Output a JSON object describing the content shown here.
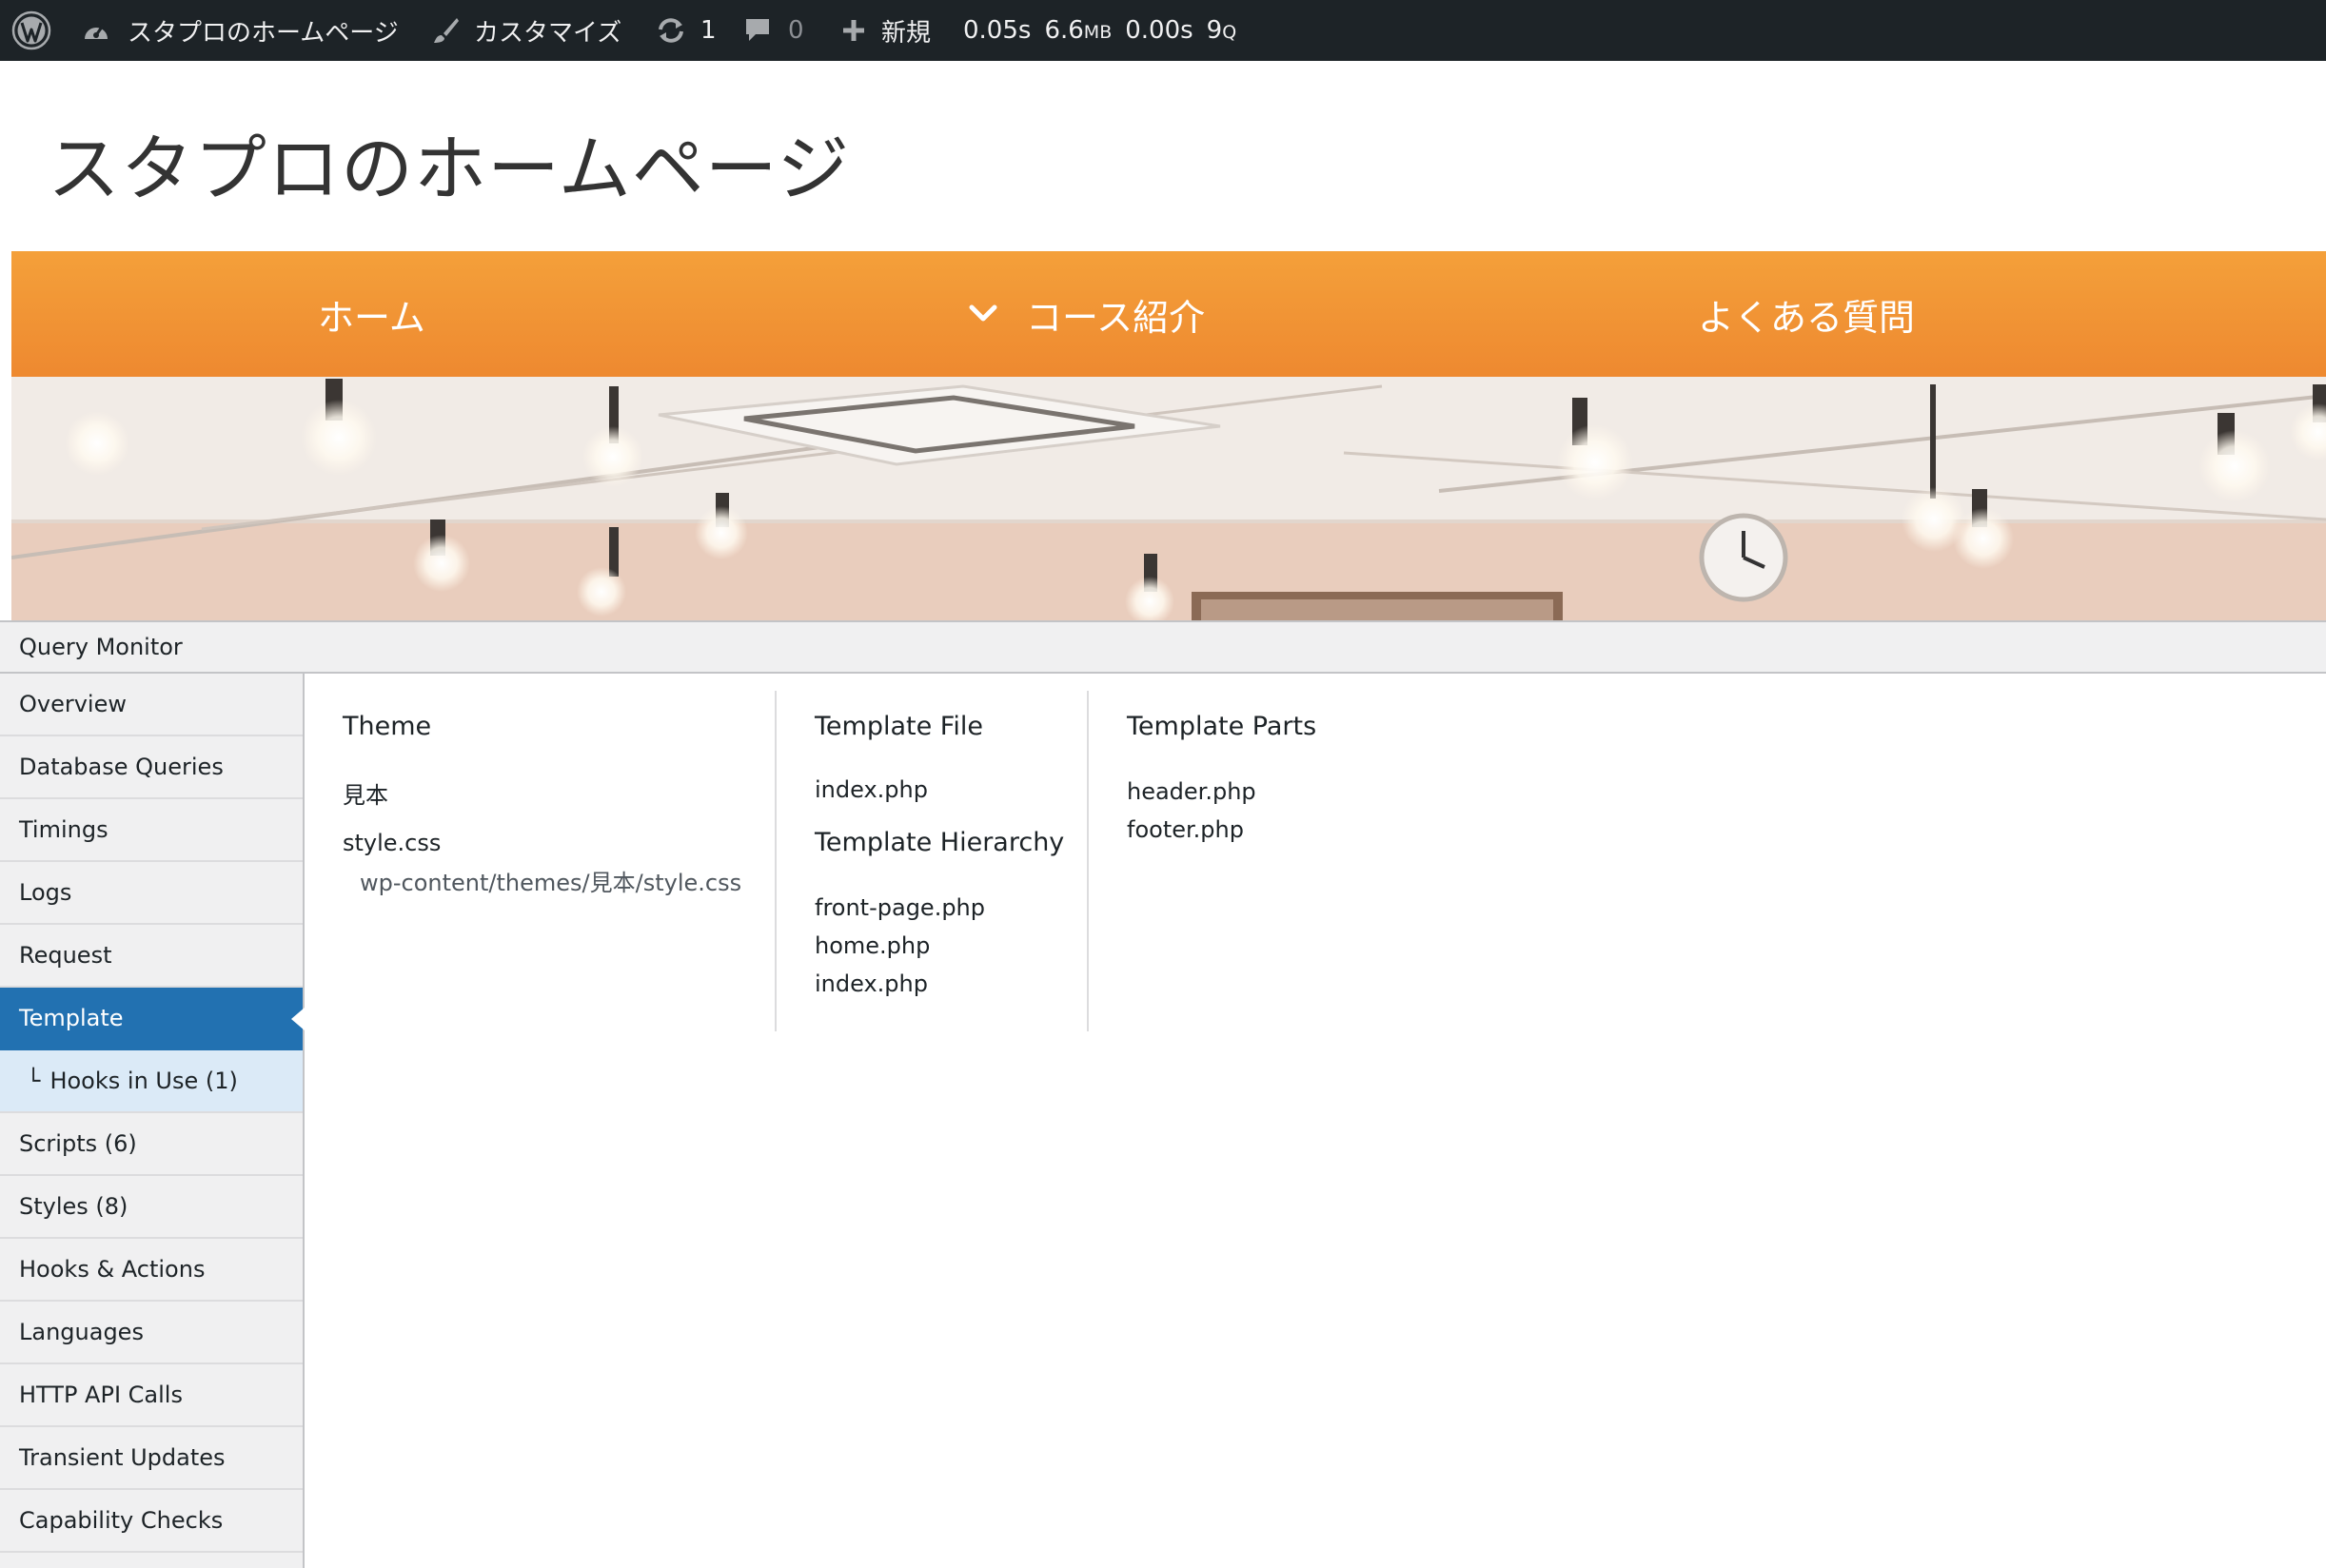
{
  "admin_bar": {
    "site_name": "スタプロのホームページ",
    "customize_label": "カスタマイズ",
    "updates_count": "1",
    "comments_count": "0",
    "new_label": "新規",
    "qm_time": "0.05s",
    "qm_memory": "6.6",
    "qm_memory_unit": "MB",
    "qm_db_time": "0.00s",
    "qm_queries": "9",
    "qm_queries_unit": "Q"
  },
  "site": {
    "title": "スタプロのホームページ",
    "nav": {
      "home": "ホーム",
      "course": "コース紹介",
      "faq": "よくある質問"
    }
  },
  "query_monitor": {
    "title": "Query Monitor",
    "nav": [
      "Overview",
      "Database Queries",
      "Timings",
      "Logs",
      "Request",
      "Template",
      "Hooks in Use (1)",
      "Scripts (6)",
      "Styles (8)",
      "Hooks & Actions",
      "Languages",
      "HTTP API Calls",
      "Transient Updates",
      "Capability Checks"
    ],
    "sub_marker": "└",
    "active_item": "Template",
    "template": {
      "theme_heading": "Theme",
      "theme_name": "見本",
      "stylesheet": "style.css",
      "stylesheet_path": "wp-content/themes/見本/style.css",
      "template_file_heading": "Template File",
      "template_file": "index.php",
      "hierarchy_heading": "Template Hierarchy",
      "hierarchy": [
        "front-page.php",
        "home.php",
        "index.php"
      ],
      "parts_heading": "Template Parts",
      "parts": [
        "header.php",
        "footer.php"
      ]
    }
  },
  "colors": {
    "admin_bar_bg": "#1d2327",
    "nav_orange": "#f39a36",
    "qm_active": "#2271b1",
    "qm_sub_bg": "#dbeaf7"
  },
  "icons": {
    "logo": "wordpress-logo-icon",
    "site": "dashboard-gauge-icon",
    "customize": "paintbrush-icon",
    "updates": "refresh-icon",
    "comments": "comment-bubble-icon",
    "new": "plus-icon",
    "nav_dropdown": "chevron-down-icon"
  }
}
